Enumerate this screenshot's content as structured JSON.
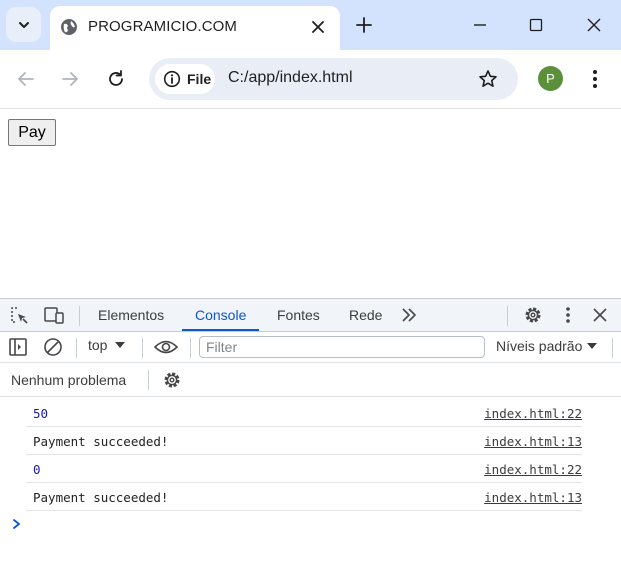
{
  "browser": {
    "tab": {
      "title": "PROGRAMICIO.COM",
      "favicon": "globe-icon"
    },
    "omnibox": {
      "chip_label": "File",
      "url": "C:/app/index.html"
    },
    "profile_initial": "P",
    "colors": {
      "tabstrip": "#d3e3fd",
      "omnibox": "#e9eef6",
      "avatar": "#5c8f3a"
    }
  },
  "page": {
    "pay_button_label": "Pay"
  },
  "devtools": {
    "tabs": [
      {
        "label": "Elementos",
        "active": false
      },
      {
        "label": "Console",
        "active": true
      },
      {
        "label": "Fontes",
        "active": false
      },
      {
        "label": "Rede",
        "active": false
      }
    ],
    "context": "top",
    "filter_placeholder": "Filter",
    "levels_label": "Níveis padrão",
    "issues_label": "Nenhum problema",
    "accent_color": "#0b57d0",
    "console": [
      {
        "message": "50",
        "source": "index.html:22",
        "type": "number"
      },
      {
        "message": "Payment succeeded!",
        "source": "index.html:13",
        "type": "string"
      },
      {
        "message": "0",
        "source": "index.html:22",
        "type": "number"
      },
      {
        "message": "Payment succeeded!",
        "source": "index.html:13",
        "type": "string"
      }
    ]
  }
}
